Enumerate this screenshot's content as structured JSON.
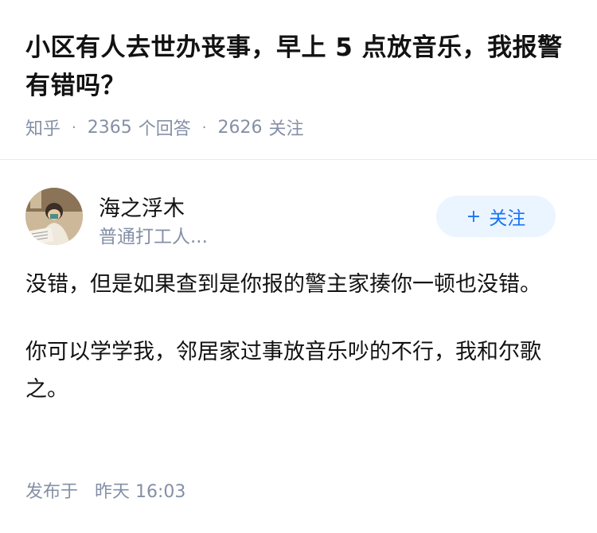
{
  "question": {
    "title": "小区有人去世办丧事，早上 5 点放音乐，我报警有错吗？",
    "source": "知乎",
    "answer_count": "2365",
    "answer_label": "个回答",
    "follow_count": "2626",
    "follow_label": "关注"
  },
  "author": {
    "name": "海之浮木",
    "bio": "普通打工人...",
    "follow_button_label": "关注",
    "follow_button_icon": "plus-icon"
  },
  "answer": {
    "paragraphs": [
      "没错，但是如果查到是你报的警主家揍你一顿也没错。",
      "你可以学学我，邻居家过事放音乐吵的不行，我和尔歌之。"
    ]
  },
  "published": {
    "label": "发布于",
    "time": "昨天 16:03"
  },
  "colors": {
    "accent": "#1772f6",
    "follow_bg": "#ebf5ff",
    "meta_gray": "#8590a6"
  }
}
